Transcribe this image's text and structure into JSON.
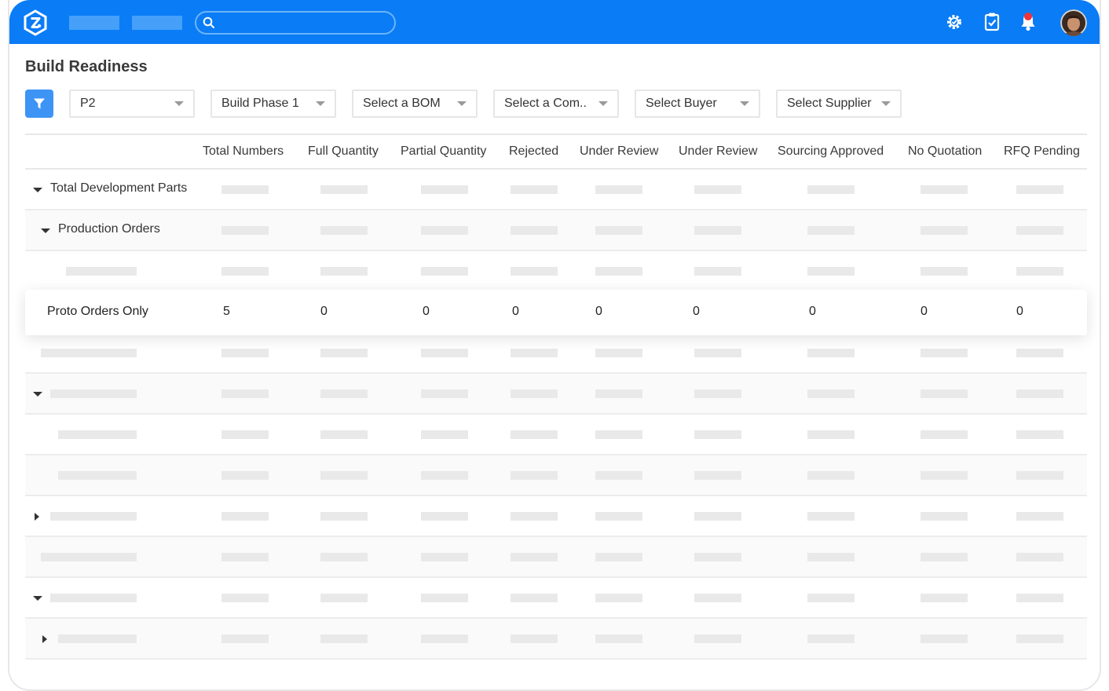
{
  "colors": {
    "topbar": "#0a7cf6",
    "accent": "#3d94f4",
    "notification": "#f0323a"
  },
  "topbar": {
    "logo_icon": "app-logo-icon",
    "search": {
      "value": "",
      "placeholder": "",
      "icon": "search-icon"
    },
    "icons": [
      "settings-gear-icon",
      "clipboard-check-icon",
      "bell-icon",
      "avatar"
    ]
  },
  "page": {
    "title": "Build Readiness"
  },
  "filters": {
    "filter_icon": "filter-icon",
    "selects": [
      {
        "value": "P2"
      },
      {
        "value": "Build Phase 1"
      },
      {
        "value": "Select a BOM"
      },
      {
        "value": "Select a Com.."
      },
      {
        "value": "Select Buyer"
      },
      {
        "value": "Select Supplier"
      }
    ]
  },
  "table": {
    "columns": [
      "Total Numbers",
      "Full Quantity",
      "Partial Quantity",
      "Rejected",
      "Under Review",
      "Under Review",
      "Sourcing Approved",
      "No Quotation",
      "RFQ Pending"
    ],
    "rows": [
      {
        "label": "Total Development Parts",
        "expanded": true
      },
      {
        "label": "Production Orders",
        "expanded": true
      }
    ],
    "highlighted_row": {
      "label": "Proto Orders Only",
      "values": [
        "5",
        "0",
        "0",
        "0",
        "0",
        "0",
        "0",
        "0",
        "0"
      ]
    }
  }
}
